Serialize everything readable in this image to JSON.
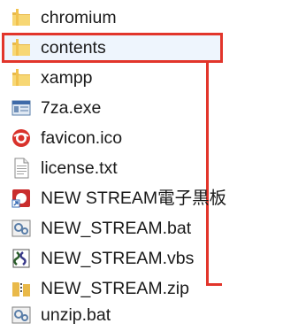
{
  "files": [
    {
      "name": "chromium",
      "icon": "folder-icon"
    },
    {
      "name": "contents",
      "icon": "folder-icon"
    },
    {
      "name": "xampp",
      "icon": "folder-icon"
    },
    {
      "name": "7za.exe",
      "icon": "executable-icon"
    },
    {
      "name": "favicon.ico",
      "icon": "favicon-icon"
    },
    {
      "name": "license.txt",
      "icon": "text-file-icon"
    },
    {
      "name": "NEW STREAM電子黒板",
      "icon": "shortcut-icon"
    },
    {
      "name": "NEW_STREAM.bat",
      "icon": "batch-file-icon"
    },
    {
      "name": "NEW_STREAM.vbs",
      "icon": "script-file-icon"
    },
    {
      "name": "NEW_STREAM.zip",
      "icon": "zip-folder-icon"
    },
    {
      "name": "unzip.bat",
      "icon": "batch-file-icon"
    }
  ],
  "selected": "contents",
  "colors": {
    "highlight_border": "#e2352b",
    "selection_fill": "#eef5fd",
    "folder_yellow": "#f2c94c"
  }
}
